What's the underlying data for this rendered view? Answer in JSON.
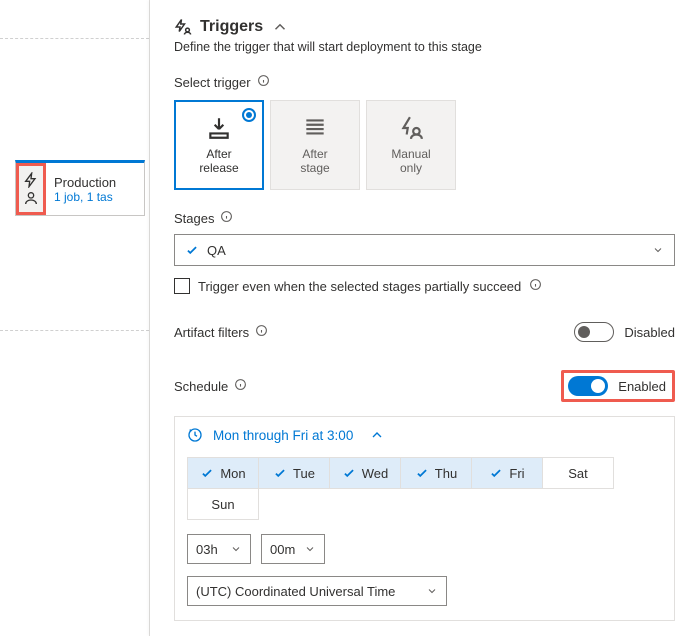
{
  "stage_card": {
    "name": "Production",
    "sub": "1 job, 1 tas"
  },
  "panel": {
    "title": "Triggers",
    "subtitle": "Define the trigger that will start deployment to this stage",
    "select_trigger_label": "Select trigger"
  },
  "trigger_options": {
    "after_release": "After\nrelease",
    "after_stage": "After\nstage",
    "manual_only": "Manual\nonly"
  },
  "stages": {
    "label": "Stages",
    "value": "QA",
    "partial_label": "Trigger even when the selected stages partially succeed"
  },
  "artifact": {
    "label": "Artifact filters",
    "status": "Disabled"
  },
  "schedule": {
    "label": "Schedule",
    "status": "Enabled",
    "summary": "Mon through Fri at 3:00",
    "days": {
      "mon": "Mon",
      "tue": "Tue",
      "wed": "Wed",
      "thu": "Thu",
      "fri": "Fri",
      "sat": "Sat",
      "sun": "Sun"
    },
    "hour": "03h",
    "minute": "00m",
    "timezone": "(UTC) Coordinated Universal Time"
  }
}
